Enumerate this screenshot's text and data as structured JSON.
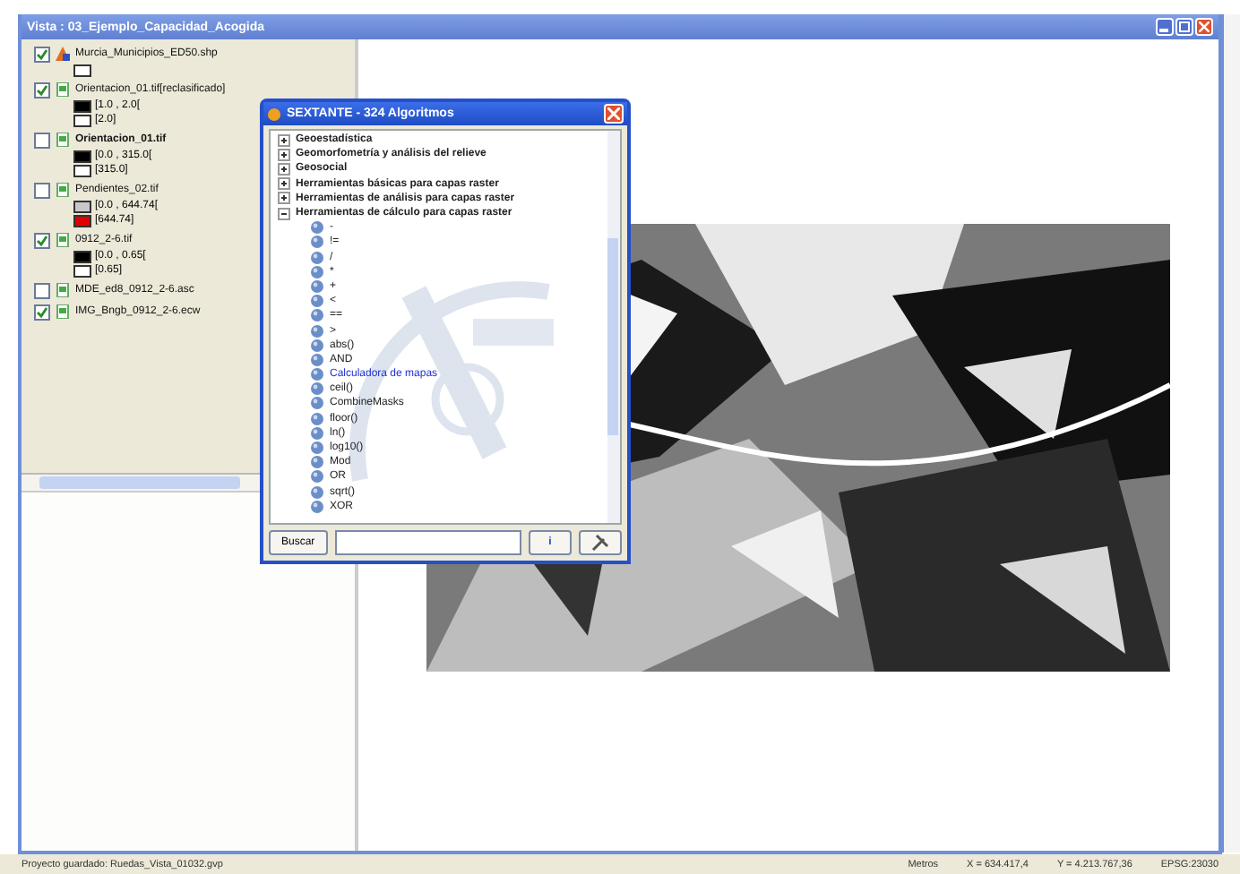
{
  "window": {
    "title": "Vista : 03_Ejemplo_Capacidad_Acogida"
  },
  "layers": [
    {
      "name": "Murcia_Municipios_ED50.shp",
      "kind": "vector",
      "checked": true,
      "active": false,
      "legend": [
        {
          "color": "#ffffff"
        }
      ]
    },
    {
      "name": "Orientacion_01.tif[reclasificado]",
      "kind": "raster",
      "checked": true,
      "active": false,
      "legend": [
        {
          "label": "[1.0 , 2.0[",
          "color": "#000000"
        },
        {
          "label": "[2.0]",
          "color": "#ffffff"
        }
      ]
    },
    {
      "name": "Orientacion_01.tif",
      "kind": "raster",
      "checked": false,
      "active": true,
      "legend": [
        {
          "label": "[0.0 , 315.0[",
          "color": "#000000"
        },
        {
          "label": "[315.0]",
          "color": "#ffffff"
        }
      ]
    },
    {
      "name": "Pendientes_02.tif",
      "kind": "raster",
      "checked": false,
      "active": false,
      "legend": [
        {
          "label": "[0.0 , 644.74[",
          "color": "#c8c8c8"
        },
        {
          "label": "[644.74]",
          "color": "#e00000"
        }
      ]
    },
    {
      "name": "0912_2-6.tif",
      "kind": "raster",
      "checked": true,
      "active": false,
      "legend": [
        {
          "label": "[0.0 , 0.65[",
          "color": "#000000"
        },
        {
          "label": "[0.65]",
          "color": "#ffffff"
        }
      ]
    },
    {
      "name": "MDE_ed8_0912_2-6.asc",
      "kind": "raster",
      "checked": false,
      "active": false
    },
    {
      "name": "IMG_Bngb_0912_2-6.ecw",
      "kind": "raster",
      "checked": true,
      "active": false
    }
  ],
  "dialog": {
    "title": "SEXTANTE - 324 Algoritmos",
    "groups": [
      {
        "label": "Geoestadística",
        "expanded": false
      },
      {
        "label": "Geomorfometría y análisis del relieve",
        "expanded": false
      },
      {
        "label": "Geosocial",
        "expanded": false
      },
      {
        "label": "Herramientas básicas para capas raster",
        "expanded": false
      },
      {
        "label": "Herramientas de análisis para capas raster",
        "expanded": false
      },
      {
        "label": "Herramientas de cálculo para capas raster",
        "expanded": true,
        "children": [
          {
            "label": "-",
            "selected": false
          },
          {
            "label": "!=",
            "selected": false
          },
          {
            "label": "/",
            "selected": false
          },
          {
            "label": "*",
            "selected": false
          },
          {
            "label": "+",
            "selected": false
          },
          {
            "label": "<",
            "selected": false
          },
          {
            "label": "==",
            "selected": false
          },
          {
            "label": ">",
            "selected": false
          },
          {
            "label": "abs()",
            "selected": false
          },
          {
            "label": "AND",
            "selected": false
          },
          {
            "label": "Calculadora de mapas",
            "selected": true
          },
          {
            "label": "ceil()",
            "selected": false
          },
          {
            "label": "CombineMasks",
            "selected": false
          },
          {
            "label": "floor()",
            "selected": false
          },
          {
            "label": "ln()",
            "selected": false
          },
          {
            "label": "log10()",
            "selected": false
          },
          {
            "label": "Mod",
            "selected": false
          },
          {
            "label": "OR",
            "selected": false
          },
          {
            "label": "sqrt()",
            "selected": false
          },
          {
            "label": "XOR",
            "selected": false
          }
        ]
      }
    ],
    "search_button": "Buscar",
    "info_button": "i"
  },
  "status_bar": {
    "message": "Proyecto guardado: Ruedas_Vista_01032.gvp",
    "units": "Metros",
    "x": "X = 634.417,4",
    "y": "Y = 4.213.767,36",
    "crs": "EPSG:23030"
  }
}
